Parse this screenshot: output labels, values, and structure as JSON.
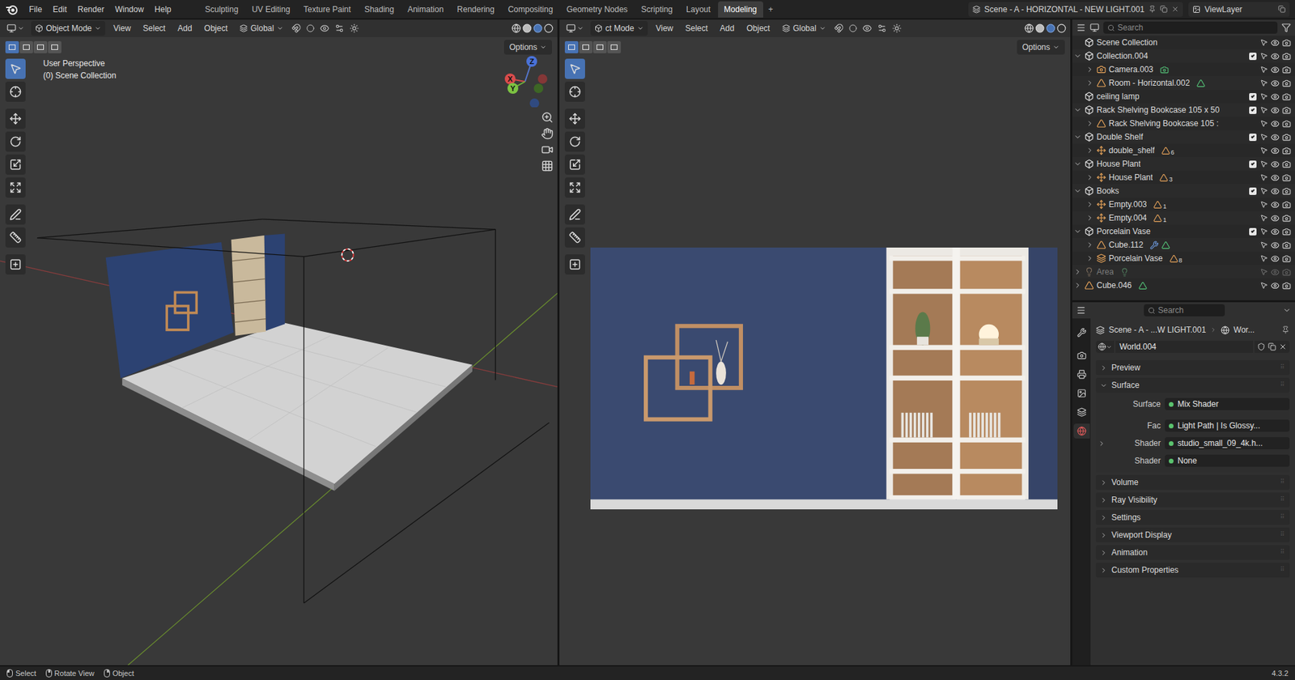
{
  "menu": [
    "File",
    "Edit",
    "Render",
    "Window",
    "Help"
  ],
  "workspaces": [
    {
      "label": "Sculpting",
      "selected": false
    },
    {
      "label": "UV Editing",
      "selected": false
    },
    {
      "label": "Texture Paint",
      "selected": false
    },
    {
      "label": "Shading",
      "selected": false
    },
    {
      "label": "Animation",
      "selected": false
    },
    {
      "label": "Rendering",
      "selected": false
    },
    {
      "label": "Compositing",
      "selected": false
    },
    {
      "label": "Geometry Nodes",
      "selected": false
    },
    {
      "label": "Scripting",
      "selected": false
    },
    {
      "label": "Layout",
      "selected": false
    },
    {
      "label": "Modeling",
      "selected": true
    }
  ],
  "add_workspace": "+",
  "scene": {
    "name": "Scene - A - HORIZONTAL - NEW LIGHT.001",
    "view_layer": "ViewLayer"
  },
  "viewport_left": {
    "mode": "Object Mode",
    "menus": [
      "View",
      "Select",
      "Add",
      "Object"
    ],
    "orientation": "Global",
    "options": "Options",
    "overlay_lines": [
      "User Perspective",
      "(0) Scene Collection"
    ],
    "gizmo_axes": [
      "Z",
      "Y",
      "X"
    ],
    "tools": [
      {
        "tool": "select",
        "selected": true
      },
      {
        "tool": "cursor",
        "selected": false
      },
      {
        "tool": "move",
        "selected": false
      },
      {
        "tool": "rotate",
        "selected": false
      },
      {
        "tool": "scale",
        "selected": false
      },
      {
        "tool": "transform",
        "selected": false
      },
      {
        "tool": "annotate",
        "selected": false
      },
      {
        "tool": "measure",
        "selected": false
      },
      {
        "tool": "add_cube",
        "selected": false
      }
    ]
  },
  "viewport_right": {
    "mode": "ct Mode",
    "menus": [
      "View",
      "Select",
      "Add",
      "Object"
    ],
    "orientation": "Global",
    "options": "Options",
    "tools": [
      {
        "tool": "select",
        "selected": true
      },
      {
        "tool": "cursor",
        "selected": false
      },
      {
        "tool": "move",
        "selected": false
      },
      {
        "tool": "rotate",
        "selected": false
      },
      {
        "tool": "scale",
        "selected": false
      },
      {
        "tool": "transform",
        "selected": false
      },
      {
        "tool": "annotate",
        "selected": false
      },
      {
        "tool": "measure",
        "selected": false
      },
      {
        "tool": "add_cube",
        "selected": false
      }
    ]
  },
  "outliner": {
    "search": "Search",
    "rows": [
      {
        "name": "Scene Collection",
        "depth": 0,
        "kind": "scene_collection",
        "disabled": false,
        "data_icons": [],
        "count": ""
      },
      {
        "name": "Collection.004",
        "depth": 0,
        "kind": "collection",
        "expanded": true,
        "checked": true,
        "disabled": false,
        "data_icons": [],
        "count": ""
      },
      {
        "name": "Camera.003",
        "depth": 1,
        "kind": "camera",
        "expanded": false,
        "disabled": false,
        "data_icons": [
          "camera_data"
        ],
        "count": ""
      },
      {
        "name": "Room - Horizontal.002",
        "depth": 1,
        "kind": "mesh",
        "expanded": false,
        "disabled": false,
        "data_icons": [
          "mesh_data"
        ],
        "count": ""
      },
      {
        "name": "ceiling lamp",
        "depth": 0,
        "kind": "collection",
        "checked": true,
        "disabled": false,
        "data_icons": [],
        "count": ""
      },
      {
        "name": "Rack Shelving Bookcase 105 x 50",
        "depth": 0,
        "kind": "collection",
        "expanded": true,
        "checked": true,
        "disabled": false,
        "data_icons": [],
        "count": ""
      },
      {
        "name": "Rack Shelving Bookcase 105 :",
        "depth": 1,
        "kind": "mesh",
        "expanded": false,
        "disabled": false,
        "data_icons": [],
        "count": ""
      },
      {
        "name": "Double Shelf",
        "depth": 0,
        "kind": "collection",
        "expanded": true,
        "checked": true,
        "disabled": false,
        "data_icons": [],
        "count": ""
      },
      {
        "name": "double_shelf",
        "depth": 1,
        "kind": "empty",
        "expanded": false,
        "disabled": false,
        "data_icons": [
          "mesh"
        ],
        "count": "6"
      },
      {
        "name": "House Plant",
        "depth": 0,
        "kind": "collection",
        "expanded": true,
        "checked": true,
        "disabled": false,
        "data_icons": [],
        "count": ""
      },
      {
        "name": "House Plant",
        "depth": 1,
        "kind": "empty",
        "expanded": false,
        "disabled": false,
        "data_icons": [
          "mesh"
        ],
        "count": "3"
      },
      {
        "name": "Books",
        "depth": 0,
        "kind": "collection",
        "expanded": true,
        "checked": true,
        "disabled": false,
        "data_icons": [],
        "count": ""
      },
      {
        "name": "Empty.003",
        "depth": 1,
        "kind": "empty",
        "expanded": false,
        "disabled": false,
        "data_icons": [
          "mesh"
        ],
        "count": "1"
      },
      {
        "name": "Empty.004",
        "depth": 1,
        "kind": "empty",
        "expanded": false,
        "disabled": false,
        "data_icons": [
          "mesh"
        ],
        "count": "1"
      },
      {
        "name": "Porcelain Vase",
        "depth": 0,
        "kind": "collection",
        "expanded": true,
        "checked": true,
        "disabled": false,
        "data_icons": [],
        "count": ""
      },
      {
        "name": "Cube.112",
        "depth": 1,
        "kind": "mesh",
        "expanded": false,
        "disabled": false,
        "data_icons": [
          "modifier",
          "mesh_data"
        ],
        "count": ""
      },
      {
        "name": "Porcelain Vase",
        "depth": 1,
        "kind": "group",
        "expanded": false,
        "disabled": false,
        "data_icons": [
          "mesh"
        ],
        "count": "8"
      },
      {
        "name": "Area",
        "depth": 0,
        "kind": "light",
        "expanded": false,
        "disabled": true,
        "data_icons": [
          "light_data"
        ],
        "count": ""
      },
      {
        "name": "Cube.046",
        "depth": 0,
        "kind": "mesh",
        "expanded": false,
        "disabled": false,
        "data_icons": [
          "mesh_data"
        ],
        "count": ""
      }
    ]
  },
  "properties": {
    "search": "Search",
    "breadcrumb": [
      "Scene - A - ...W LIGHT.001",
      "Wor..."
    ],
    "datablock": "World.004",
    "tabs": [
      {
        "kind": "tool",
        "selected": false
      },
      {
        "kind": "render",
        "selected": false
      },
      {
        "kind": "output",
        "selected": false
      },
      {
        "kind": "view_layer",
        "selected": false
      },
      {
        "kind": "scene",
        "selected": false
      },
      {
        "kind": "world",
        "selected": true
      }
    ],
    "panels": [
      {
        "label": "Preview",
        "expanded": false
      },
      {
        "label": "Surface",
        "expanded": true
      },
      {
        "label": "Volume",
        "expanded": false
      },
      {
        "label": "Ray Visibility",
        "expanded": false
      },
      {
        "label": "Settings",
        "expanded": false
      },
      {
        "label": "Viewport Display",
        "expanded": false
      },
      {
        "label": "Animation",
        "expanded": false
      },
      {
        "label": "Custom Properties",
        "expanded": false
      }
    ],
    "surface_fields": [
      {
        "label": "Surface",
        "value": "Mix Shader",
        "expandable": false
      },
      {
        "label": "Fac",
        "value": "Light Path | Is Glossy...",
        "expandable": false
      },
      {
        "label": "Shader",
        "value": "studio_small_09_4k.h...",
        "expandable": true
      },
      {
        "label": "Shader",
        "value": "None",
        "expandable": false
      }
    ]
  },
  "status_bar": {
    "items": [
      "Select",
      "Rotate View",
      "Object"
    ],
    "version": "4.3.2"
  }
}
